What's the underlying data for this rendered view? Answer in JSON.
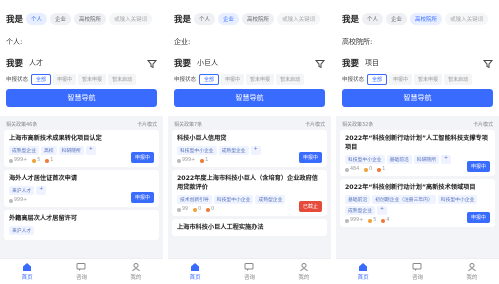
{
  "accent_color": "#3a6bff",
  "closed_color": "#e64a3b",
  "screens": [
    {
      "who_label": "我是",
      "who_chips": [
        {
          "label": "个人",
          "active": true,
          "placeholder": false
        },
        {
          "label": "企业",
          "active": false,
          "placeholder": false
        },
        {
          "label": "高校院所",
          "active": false,
          "placeholder": false
        },
        {
          "label": "或输入关键词",
          "active": false,
          "placeholder": true
        }
      ],
      "context_label": "个人:",
      "want_label": "我要",
      "want_value": "人才",
      "status_label": "申报状态",
      "status_options": [
        {
          "label": "全部",
          "active": true
        },
        {
          "label": "申报中",
          "active": false
        },
        {
          "label": "暂未申报",
          "active": false
        },
        {
          "label": "暂未启动",
          "active": false
        }
      ],
      "nav_button": "智慧导航",
      "count_text": "相关政策46条",
      "view_mode": "卡片模式",
      "cards": [
        {
          "title": "上海市高新技术成果转化项目认定",
          "tags": [
            "成熟型企业",
            "高校",
            "科研院所",
            "+"
          ],
          "views": "999+",
          "stat2": "5",
          "stat3": "1",
          "badge": "申报中",
          "badge_closed": false
        },
        {
          "title": "海外人才居住证首次申请",
          "tags": [
            "来沪人才",
            "+"
          ],
          "views": "999+",
          "stat2": "",
          "stat3": "",
          "badge": "申报中",
          "badge_closed": false
        },
        {
          "title": "外籍高层次人才居留许可",
          "tags": [
            "来沪人才"
          ],
          "views": "",
          "stat2": "",
          "stat3": "",
          "badge": "",
          "badge_closed": false
        }
      ],
      "tabbar": [
        {
          "label": "首页",
          "icon": "home-icon",
          "active": true
        },
        {
          "label": "咨询",
          "icon": "chat-icon",
          "active": false
        },
        {
          "label": "我的",
          "icon": "user-icon",
          "active": false
        }
      ]
    },
    {
      "who_label": "我是",
      "who_chips": [
        {
          "label": "个人",
          "active": false,
          "placeholder": false
        },
        {
          "label": "企业",
          "active": true,
          "placeholder": false
        },
        {
          "label": "高校院所",
          "active": false,
          "placeholder": false
        },
        {
          "label": "或输入关键词",
          "active": false,
          "placeholder": true
        }
      ],
      "context_label": "企业:",
      "want_label": "我要",
      "want_value": "小巨人",
      "status_label": "申报状态",
      "status_options": [
        {
          "label": "全部",
          "active": true
        },
        {
          "label": "申报中",
          "active": false
        },
        {
          "label": "暂未申报",
          "active": false
        },
        {
          "label": "暂未启动",
          "active": false
        }
      ],
      "nav_button": "智慧导航",
      "count_text": "相关政策7条",
      "view_mode": "卡片模式",
      "cards": [
        {
          "title": "科技小巨人信用贷",
          "tags": [
            "科技型中小企业",
            "成熟型企业",
            "+"
          ],
          "views": "999+",
          "stat2": "",
          "stat3": "1",
          "badge": "申报中",
          "badge_closed": false
        },
        {
          "title": "2022年度上海市科技小巨人（含培育）企业政府信用贷款评价",
          "tags": [
            "技术创新引导",
            "科技型中小企业",
            "成熟型企业"
          ],
          "views": "99",
          "stat2": "0",
          "stat3": "0",
          "badge": "已截止",
          "badge_closed": true
        },
        {
          "title": "上海市科技小巨人工程实施办法",
          "tags": [],
          "views": "",
          "stat2": "",
          "stat3": "",
          "badge": "",
          "badge_closed": false
        }
      ],
      "tabbar": [
        {
          "label": "首页",
          "icon": "home-icon",
          "active": true
        },
        {
          "label": "咨询",
          "icon": "chat-icon",
          "active": false
        },
        {
          "label": "我的",
          "icon": "user-icon",
          "active": false
        }
      ]
    },
    {
      "who_label": "我是",
      "who_chips": [
        {
          "label": "个人",
          "active": false,
          "placeholder": false
        },
        {
          "label": "企业",
          "active": false,
          "placeholder": false
        },
        {
          "label": "高校院所",
          "active": true,
          "placeholder": false
        },
        {
          "label": "或输入关键词",
          "active": false,
          "placeholder": true
        }
      ],
      "context_label": "高校院所:",
      "want_label": "我要",
      "want_value": "项目",
      "status_label": "申报状态",
      "status_options": [
        {
          "label": "全部",
          "active": true
        },
        {
          "label": "申报中",
          "active": false
        },
        {
          "label": "暂未申报",
          "active": false
        },
        {
          "label": "暂未启动",
          "active": false
        }
      ],
      "nav_button": "智慧导航",
      "count_text": "相关政策32条",
      "view_mode": "卡片模式",
      "cards": [
        {
          "title": "2022年“科技创新行动计划”人工智能科技支撑专项项目",
          "tags": [
            "科技型中小企业",
            "基础前沿",
            "科研院所",
            "+"
          ],
          "views": "484",
          "stat2": "0",
          "stat3": "1",
          "badge": "申报中",
          "badge_closed": false
        },
        {
          "title": "2022年“科技创新行动计划”高新技术领域项目",
          "tags": [
            "基础前沿",
            "初创期企业（注册三年内）",
            "科技型中小企业",
            "成熟型企业",
            "+"
          ],
          "views": "999+",
          "stat2": "5",
          "stat3": "4",
          "badge": "申报中",
          "badge_closed": false
        }
      ],
      "tabbar": [
        {
          "label": "首页",
          "icon": "home-icon",
          "active": true
        },
        {
          "label": "咨询",
          "icon": "chat-icon",
          "active": false
        },
        {
          "label": "我的",
          "icon": "user-icon",
          "active": false
        }
      ]
    }
  ]
}
